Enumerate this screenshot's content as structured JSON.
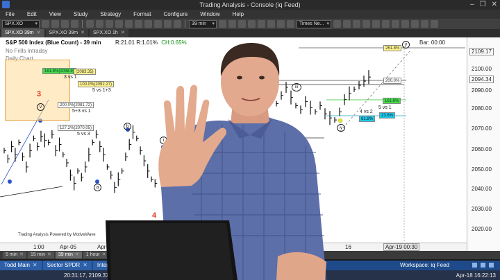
{
  "window": {
    "title": "Trading Analysis - Console (iq Feed)",
    "controls": [
      "–",
      "❐",
      "✕"
    ]
  },
  "menu": [
    "File",
    "Edit",
    "View",
    "Study",
    "Strategy",
    "Format",
    "Configure",
    "Window",
    "Help"
  ],
  "toolbar": {
    "symbol": "SPX.XO",
    "interval": "39 min",
    "font": "Times Ne..."
  },
  "chart_tabs": [
    {
      "label": "SPX.XO 39m",
      "active": true
    },
    {
      "label": "SPX.XO 39m",
      "active": false
    },
    {
      "label": "SPX.XO 1h",
      "active": false
    }
  ],
  "chart": {
    "title": "S&P 500 Index (Blue Count) - 39 min",
    "r1": "R:21.01",
    "r2": "R:1.01%",
    "change": "CH:0.65%",
    "bar_time": "Bar: 00:00",
    "subtitle1": "No Frills Intraday",
    "subtitle2": "Daily Chart",
    "powered_by": "Trading Analysis Powered by MotiveWave",
    "current_price": "2094.34",
    "top_price": "2109.17",
    "price_ticks": [
      "2100.00",
      "2090.00",
      "2080.00",
      "2070.00",
      "2060.00",
      "2050.00",
      "2040.00",
      "2030.00",
      "2020.00"
    ],
    "time_ticks": [
      "1:00",
      "Apr-05",
      "Apr-06",
      "16"
    ],
    "time_cursor": "Apr-19 00:30",
    "fib_labels": {
      "f1": "161.8%(2098.9)",
      "f1b": "(2083.35)",
      "f1c": "3 vs 1",
      "f2": "100.0%(2092.27)",
      "f2c": "5 vs 1+3",
      "f3": "200.0%(2081.72)",
      "f3c": "5+3 vs 1",
      "f4": "127.2%(2070.05)",
      "f4c": "5 vs 3",
      "r1": "261.8%",
      "r2": "200.0%",
      "r3": "161.8%",
      "r4": "4 vs 2",
      "r4b": "5 vs 1",
      "r5": "61.8%",
      "r6": "23.6%"
    },
    "wave_labels": {
      "three": "3",
      "four": "4",
      "v": "v",
      "a": "a",
      "b": "b",
      "i": "i",
      "iii": "iii",
      "iv": "iv",
      "y": "y"
    }
  },
  "chart_data": {
    "type": "ohlc",
    "y_range": [
      2015,
      2112
    ],
    "ticks": [
      2100,
      2090,
      2080,
      2070,
      2060,
      2050,
      2040,
      2030,
      2020
    ],
    "series_left": [
      2060,
      2056,
      2062,
      2058,
      2064,
      2057,
      2052,
      2060,
      2066,
      2062,
      2067,
      2065,
      2064,
      2068,
      2060,
      2063,
      2058,
      2054,
      2048,
      2044,
      2050,
      2047,
      2052,
      2058,
      2064,
      2068,
      2062,
      2058,
      2052,
      2048,
      2042,
      2046,
      2050,
      2057,
      2063,
      2069,
      2066,
      2060,
      2055,
      2050,
      2046,
      2044
    ],
    "series_right": [
      2083,
      2087,
      2091,
      2086,
      2082,
      2080,
      2084,
      2081,
      2079,
      2082,
      2078,
      2076,
      2075,
      2079,
      2085,
      2088,
      2090,
      2092,
      2094,
      2096
    ]
  },
  "bottom_tabs": [
    {
      "label": "5 min",
      "active": false
    },
    {
      "label": "15 min",
      "active": false
    },
    {
      "label": "39 min",
      "active": true
    },
    {
      "label": "1 hour",
      "active": false
    },
    {
      "label": "4 hour",
      "active": false
    }
  ],
  "workspace_tabs": [
    {
      "label": "Todd Main"
    },
    {
      "label": "Sector SPDR"
    },
    {
      "label": "Interm..."
    }
  ],
  "workspace": "Workspace: iq Feed",
  "status": {
    "cursor": "20:31:17, 2109.37",
    "datetime": "Apr-18 16:22:13"
  },
  "colors": {
    "red_label": "#e1371d",
    "fib_green": "#4dd64d",
    "fib_yellow": "#fff38c",
    "fib_cyan": "#20c8e6"
  }
}
